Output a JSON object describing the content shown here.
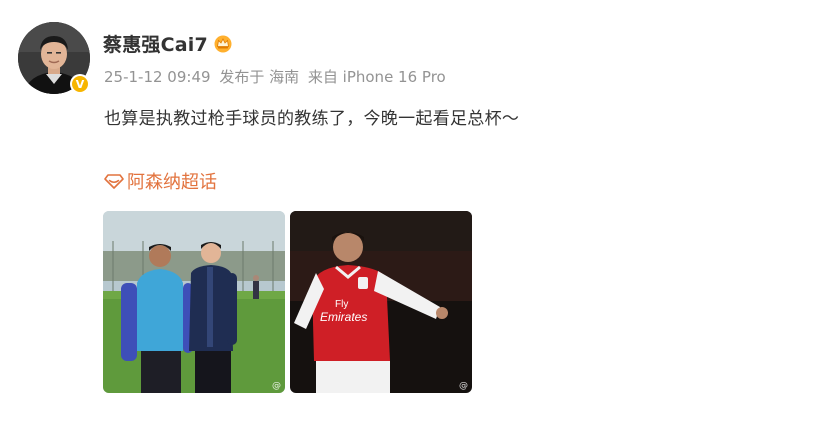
{
  "user": {
    "name": "蔡惠强Cai7",
    "verified_badge": "V",
    "crown_icon": "crown-icon"
  },
  "meta": {
    "time": "25-1-12 09:49",
    "location": "发布于 海南",
    "source": "来自 iPhone 16 Pro"
  },
  "post": {
    "text": "也算是执教过枪手球员的教练了，今晚一起看足总杯～"
  },
  "topic": {
    "icon": "supertopic-diamond-icon",
    "label": "阿森纳超话"
  },
  "images": [
    {
      "name": "photo-two-coaches",
      "watermark": "@"
    },
    {
      "name": "photo-arsenal-player",
      "watermark": "@"
    }
  ],
  "jersey": {
    "sponsor_line1": "Fly",
    "sponsor_line2": "Emirates"
  },
  "colors": {
    "topic": "#e2733e",
    "meta": "#939393",
    "text": "#333333",
    "badge": "#f7b500"
  }
}
